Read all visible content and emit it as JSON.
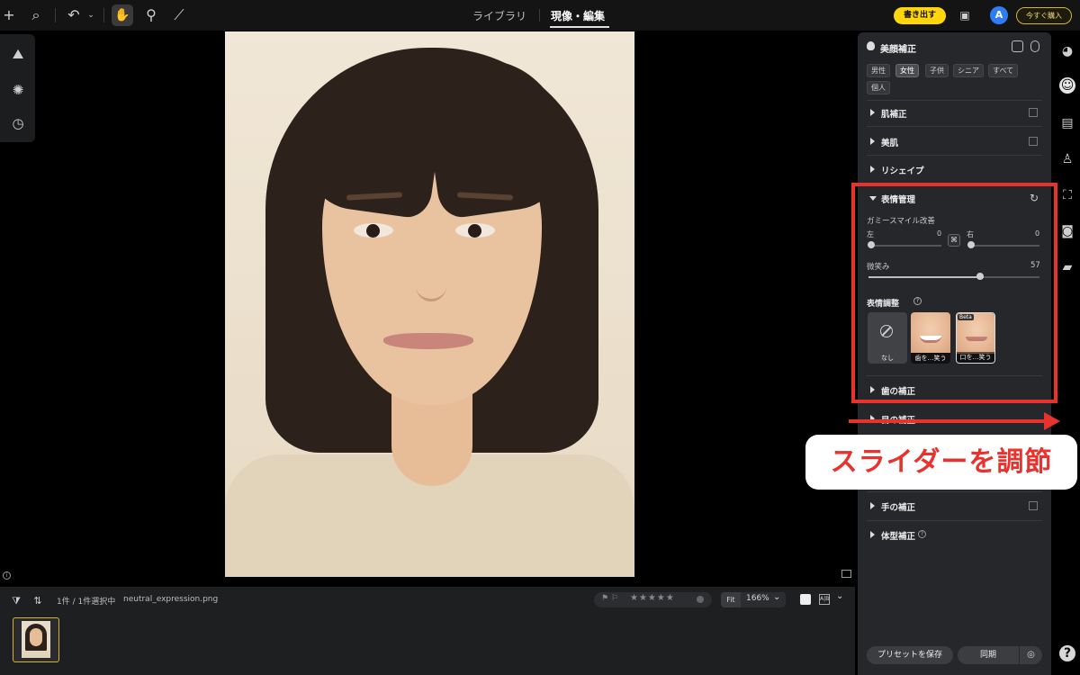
{
  "topbar": {
    "tabs": [
      {
        "label": "ライブラリ",
        "active": false
      },
      {
        "label": "現像・編集",
        "active": true
      }
    ],
    "export_label": "書き出す",
    "avatar_letter": "A",
    "buy_label": "今すぐ購入"
  },
  "panel": {
    "title": "美顔補正",
    "filters": [
      "男性",
      "女性",
      "子供",
      "シニア",
      "すべて",
      "個人"
    ],
    "selected_filter": "女性",
    "sections": {
      "skin_fix": "肌補正",
      "beauty_skin": "美肌",
      "reshape": "リシェイプ",
      "expression": "表情管理",
      "teeth": "歯の補正",
      "eyes": "目の補正",
      "hands": "手の補正",
      "body": "体型補正"
    },
    "gummy": {
      "label": "ガミースマイル改善",
      "left_label": "左",
      "left_value": "0",
      "right_label": "右",
      "right_value": "0"
    },
    "smile": {
      "label": "微笑み",
      "value": "57",
      "level": 0.57
    },
    "expr_adjust": {
      "label": "表情調整",
      "options": [
        {
          "label": "なし"
        },
        {
          "label": "歯を…笑う"
        },
        {
          "label": "口を…笑う",
          "badge": "Beta"
        }
      ]
    },
    "save_preset": "プリセットを保存",
    "sync": "同期"
  },
  "callout": {
    "text": "スライダーを調節"
  },
  "filmstrip": {
    "selection": "1件 / 1件選択中",
    "filename": "neutral_expression.png",
    "fit_label": "Fit",
    "zoom": "166%"
  },
  "colors": {
    "accent_yellow": "#ffd60a",
    "highlight_red": "#e8322d"
  },
  "icons": [
    "plus-icon",
    "search-icon",
    "undo-icon",
    "hand-icon",
    "stamp-icon",
    "bandage-icon",
    "palette-icon",
    "face-icon",
    "shirt-icon",
    "camera-icon",
    "help-icon"
  ]
}
